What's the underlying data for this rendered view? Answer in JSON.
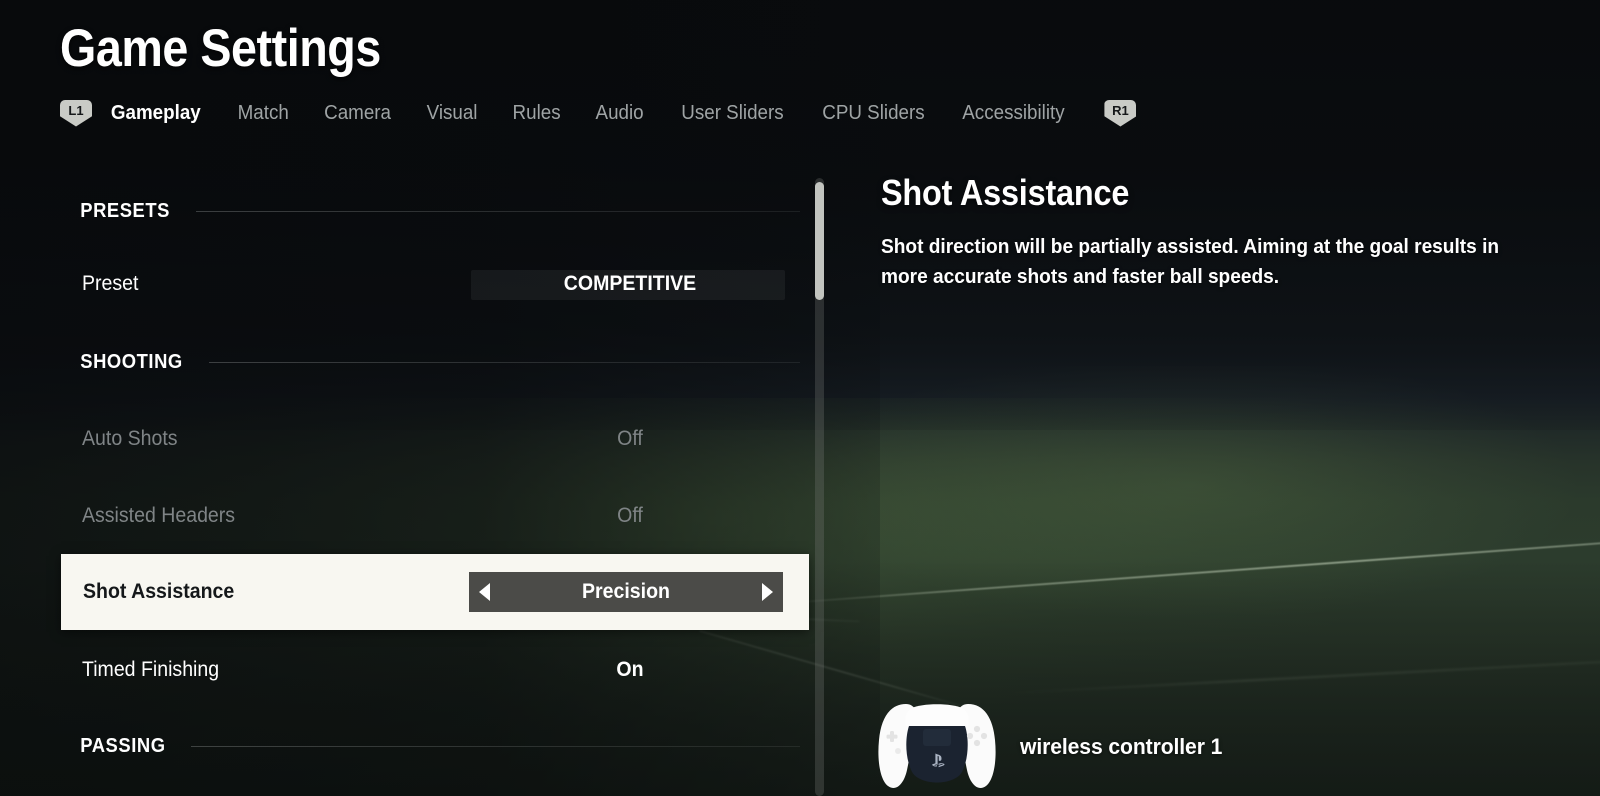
{
  "header": {
    "title": "Game Settings",
    "left_shoulder_badge": "L1",
    "right_shoulder_badge": "R1",
    "tabs": [
      {
        "label": "Gameplay",
        "active": true
      },
      {
        "label": "Match",
        "active": false
      },
      {
        "label": "Camera",
        "active": false
      },
      {
        "label": "Visual",
        "active": false
      },
      {
        "label": "Rules",
        "active": false
      },
      {
        "label": "Audio",
        "active": false
      },
      {
        "label": "User Sliders",
        "active": false
      },
      {
        "label": "CPU Sliders",
        "active": false
      },
      {
        "label": "Accessibility",
        "active": false
      }
    ]
  },
  "settings_list": {
    "rows": [
      {
        "kind": "section",
        "label": "PRESETS"
      },
      {
        "kind": "option",
        "label": "Preset",
        "value": "COMPETITIVE",
        "state": "field"
      },
      {
        "kind": "section",
        "label": "SHOOTING"
      },
      {
        "kind": "option",
        "label": "Auto Shots",
        "value": "Off",
        "state": "disabled"
      },
      {
        "kind": "option",
        "label": "Assisted Headers",
        "value": "Off",
        "state": "disabled"
      },
      {
        "kind": "option",
        "label": "Shot Assistance",
        "value": "Precision",
        "state": "selected"
      },
      {
        "kind": "option",
        "label": "Timed Finishing",
        "value": "On",
        "state": "normal"
      },
      {
        "kind": "section",
        "label": "PASSING"
      }
    ],
    "spinner": {
      "left_arrow": "arrow-left-icon",
      "right_arrow": "arrow-right-icon"
    },
    "scrollbar": {
      "position": "top"
    }
  },
  "detail": {
    "title": "Shot Assistance",
    "description": "Shot direction will be partially assisted. Aiming at the goal results in more accurate shots and faster ball speeds."
  },
  "footer": {
    "controller_icon": "ps5-dualsense-controller-icon",
    "controller_label": "wireless controller 1"
  },
  "colors": {
    "selected_row_bg": "#f8f7f1",
    "selected_row_text": "#15181a",
    "spinner_bg": "#4b4b48",
    "text_primary": "#ffffff",
    "text_muted": "#9fa4a5",
    "text_disabled": "#7f8486",
    "badge_bg": "#c9cbc6",
    "scrollbar_thumb": "#c2c4bf"
  }
}
